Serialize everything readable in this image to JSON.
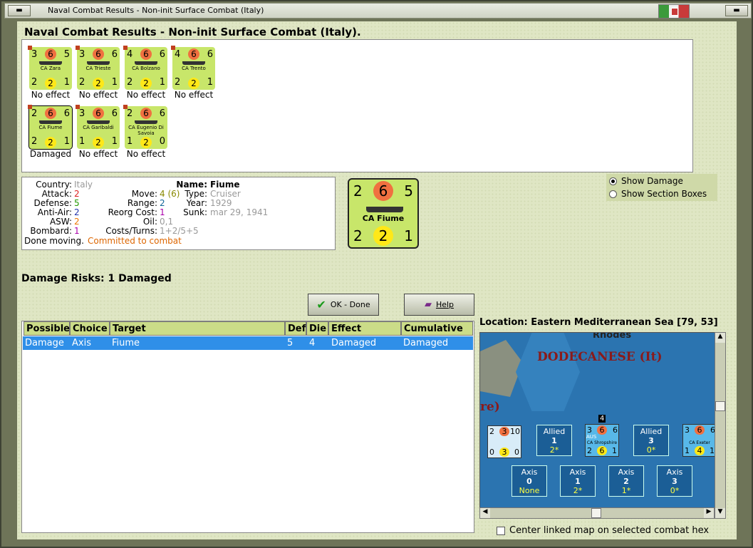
{
  "window": {
    "title": "Naval Combat Results - Non-init Surface Combat (Italy)"
  },
  "heading": "Naval Combat Results - Non-init Surface Combat (Italy).",
  "units": [
    {
      "tl": "3",
      "tr": "5",
      "red": "6",
      "bl": "2",
      "yel": "2",
      "br": "1",
      "name": "CA Zara",
      "result": "No effect"
    },
    {
      "tl": "3",
      "tr": "6",
      "red": "6",
      "bl": "2",
      "yel": "2",
      "br": "1",
      "name": "CA Trieste",
      "result": "No effect"
    },
    {
      "tl": "4",
      "tr": "6",
      "red": "6",
      "bl": "2",
      "yel": "2",
      "br": "1",
      "name": "CA Bolzano",
      "result": "No effect"
    },
    {
      "tl": "4",
      "tr": "6",
      "red": "6",
      "bl": "2",
      "yel": "2",
      "br": "1",
      "name": "CA Trento",
      "result": "No effect"
    },
    {
      "tl": "2",
      "tr": "6",
      "red": "6",
      "bl": "2",
      "yel": "2",
      "br": "1",
      "name": "CA Fiume",
      "result": "Damaged"
    },
    {
      "tl": "3",
      "tr": "6",
      "red": "6",
      "bl": "1",
      "yel": "2",
      "br": "1",
      "name": "CA Garibaldi",
      "result": "No effect"
    },
    {
      "tl": "2",
      "tr": "6",
      "red": "6",
      "bl": "1",
      "yel": "2",
      "br": "0",
      "name": "CA Eugenio Di Savoia",
      "result": "No effect"
    }
  ],
  "info": {
    "country_l": "Country:",
    "country": "Italy",
    "attack_l": "Attack:",
    "attack": "2",
    "defense_l": "Defense:",
    "defense": "5",
    "antiair_l": "Anti-Air:",
    "antiair": "2",
    "asw_l": "ASW:",
    "asw": "2",
    "bombard_l": "Bombard:",
    "bombard": "1",
    "move_l": "Move:",
    "move": "4 (6)",
    "range_l": "Range:",
    "range": "2",
    "reorg_l": "Reorg Cost:",
    "reorg": "1",
    "oil_l": "Oil:",
    "oil": "0,1",
    "costs_l": "Costs/Turns:",
    "costs": "1+2/5+5",
    "name_l": "Name:",
    "name": "Fiume",
    "type_l": "Type:",
    "type": "Cruiser",
    "year_l": "Year:",
    "year": "1929",
    "sunk_l": "Sunk:",
    "sunk": "mar 29, 1941",
    "status": "Done moving.",
    "status2": "Committed to combat"
  },
  "big_counter": {
    "tl": "2",
    "red": "6",
    "tr": "5",
    "name": "CA Fiume",
    "bl": "2",
    "yel": "2",
    "br": "1"
  },
  "options": {
    "show_damage": "Show Damage",
    "show_section": "Show Section Boxes"
  },
  "damage_risks": "Damage Risks:  1 Damaged",
  "buttons": {
    "ok": "OK - Done",
    "help": "Help"
  },
  "table": {
    "headers": [
      "Possible",
      "Choice",
      "Target",
      "Def",
      "Die",
      "Effect",
      "Cumulative"
    ],
    "rows": [
      [
        "Damage",
        "Axis",
        "Fiume",
        "5",
        "4",
        "Damaged",
        "Damaged"
      ]
    ]
  },
  "location": "Location:  Eastern Mediterranean Sea [79, 53]",
  "map": {
    "label1": "Rhodes",
    "label2": "DODECANESE (It)",
    "label3": "re)",
    "stack_count": "4",
    "allied": [
      {
        "title": "Allied",
        "num": "1",
        "val": "2*"
      },
      {
        "title": "Allied",
        "num": "3",
        "val": "0*"
      }
    ],
    "axis": [
      {
        "title": "Axis",
        "num": "0",
        "val": "None"
      },
      {
        "title": "Axis",
        "num": "1",
        "val": "2*"
      },
      {
        "title": "Axis",
        "num": "2",
        "val": "1*"
      },
      {
        "title": "Axis",
        "num": "3",
        "val": "0*"
      }
    ],
    "ship1": {
      "tl": "2",
      "red": "3",
      "tr": "10",
      "bl": "0",
      "yel": "3",
      "br": "0"
    },
    "ship2": {
      "tl": "3",
      "red": "6",
      "tr": "6",
      "name": "CA Shropshire",
      "bl": "2",
      "yel": "6",
      "br": "1",
      "flag": "AUS"
    },
    "ship3": {
      "tl": "3",
      "red": "6",
      "tr": "6",
      "name": "CA Exeter",
      "bl": "1",
      "yel": "4",
      "br": "1"
    }
  },
  "center_linked": "Center linked map on selected combat hex"
}
